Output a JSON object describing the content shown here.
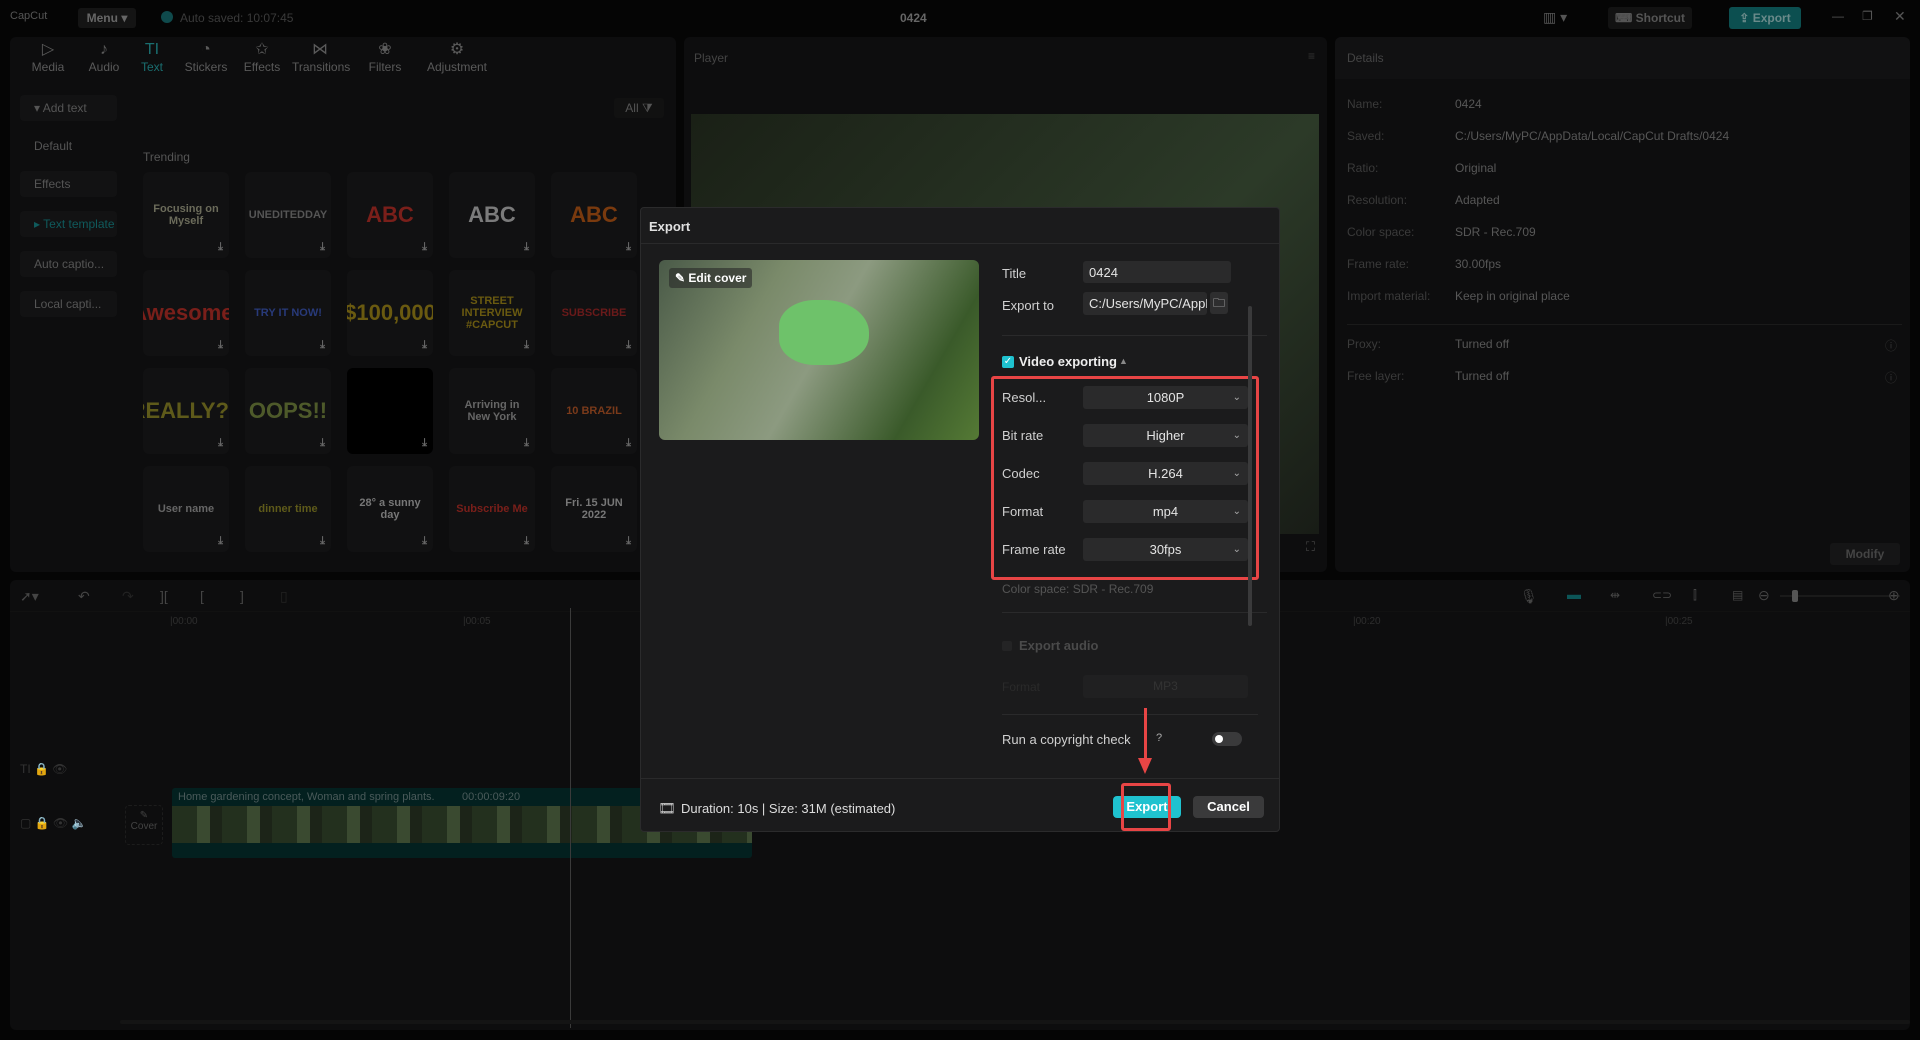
{
  "titlebar": {
    "logo": "CapCut",
    "menu": "Menu",
    "autosave": "Auto saved: 10:07:45",
    "project_title": "0424",
    "shortcut": "Shortcut",
    "export": "Export"
  },
  "tabs": [
    {
      "label": "Media",
      "icon": "▷"
    },
    {
      "label": "Audio",
      "icon": "♪"
    },
    {
      "label": "Text",
      "icon": "TI"
    },
    {
      "label": "Stickers",
      "icon": "◔"
    },
    {
      "label": "Effects",
      "icon": "✩"
    },
    {
      "label": "Transitions",
      "icon": "⋈"
    },
    {
      "label": "Filters",
      "icon": "❀"
    },
    {
      "label": "Adjustment",
      "icon": "⚙"
    }
  ],
  "sidebar": [
    "▾ Add text",
    "Default",
    "Effects",
    "▸ Text template",
    "Auto captio...",
    "Local capti..."
  ],
  "filter_all": "All",
  "trending": "Trending",
  "templates": [
    {
      "text": "Focusing on Myself",
      "color": "#6b6b5a"
    },
    {
      "text": "UNEDITEDDAY",
      "color": "#555"
    },
    {
      "text": "ABC",
      "color": "#7a1f1a"
    },
    {
      "text": "ABC",
      "color": "#7b7b7b"
    },
    {
      "text": "ABC",
      "color": "#7a3a0e"
    },
    {
      "text": "Awesome!",
      "color": "#7a1f1a"
    },
    {
      "text": "TRY IT NOW!",
      "color": "#283a7a"
    },
    {
      "text": "$100,000",
      "color": "#6a5a10"
    },
    {
      "text": "STREET INTERVIEW #CAPCUT",
      "color": "#6a5a10"
    },
    {
      "text": "SUBSCRIBE",
      "color": "#6a1a1a"
    },
    {
      "text": "REALLY??",
      "color": "#5e5a1a"
    },
    {
      "text": "OOPS!!",
      "color": "#4e5a2a"
    },
    {
      "text": "",
      "color": "#000"
    },
    {
      "text": "Arriving in New York",
      "color": "#666"
    },
    {
      "text": "10 BRAZIL",
      "color": "#7a3a1a"
    },
    {
      "text": "User name",
      "color": "#666"
    },
    {
      "text": "dinner time",
      "color": "#5e5a1a"
    },
    {
      "text": "28° a sunny day",
      "color": "#777"
    },
    {
      "text": "Subscribe Me",
      "color": "#7a1f1a"
    },
    {
      "text": "Fri. 15 JUN 2022",
      "color": "#777"
    }
  ],
  "player": {
    "title": "Player"
  },
  "details": {
    "title": "Details",
    "rows": [
      {
        "k": "Name:",
        "v": "0424"
      },
      {
        "k": "Saved:",
        "v": "C:/Users/MyPC/AppData/Local/CapCut Drafts/0424"
      },
      {
        "k": "Ratio:",
        "v": "Original"
      },
      {
        "k": "Resolution:",
        "v": "Adapted"
      },
      {
        "k": "Color space:",
        "v": "SDR - Rec.709"
      },
      {
        "k": "Frame rate:",
        "v": "30.00fps"
      },
      {
        "k": "Import material:",
        "v": "Keep in original place"
      }
    ],
    "rows2": [
      {
        "k": "Proxy:",
        "v": "Turned off"
      },
      {
        "k": "Free layer:",
        "v": "Turned off"
      }
    ],
    "modify": "Modify"
  },
  "timeline": {
    "ticks": [
      "|00:00",
      "|00:05",
      "|00:20",
      "|00:25"
    ],
    "clip_title": "Home gardening concept, Woman and spring plants.",
    "clip_duration": "00:00:09:20",
    "cover": "Cover"
  },
  "dialog": {
    "title": "Export",
    "edit_cover": "Edit cover",
    "title_label": "Title",
    "title_value": "0424",
    "export_to_label": "Export to",
    "export_to_value": "C:/Users/MyPC/AppD...",
    "video_exporting": "Video exporting",
    "video_checked": true,
    "settings": [
      {
        "label": "Resol...",
        "value": "1080P"
      },
      {
        "label": "Bit rate",
        "value": "Higher"
      },
      {
        "label": "Codec",
        "value": "H.264"
      },
      {
        "label": "Format",
        "value": "mp4"
      },
      {
        "label": "Frame rate",
        "value": "30fps"
      }
    ],
    "color_space": "Color space: SDR - Rec.709",
    "export_audio": "Export audio",
    "audio_format_label": "Format",
    "audio_format_value": "MP3",
    "copyright": "Run a copyright check",
    "copyright_on": false,
    "summary": "Duration: 10s | Size: 31M (estimated)",
    "export_button": "Export",
    "cancel_button": "Cancel"
  },
  "colors": {
    "accent": "#1fc2cf",
    "highlight": "#e84545"
  }
}
